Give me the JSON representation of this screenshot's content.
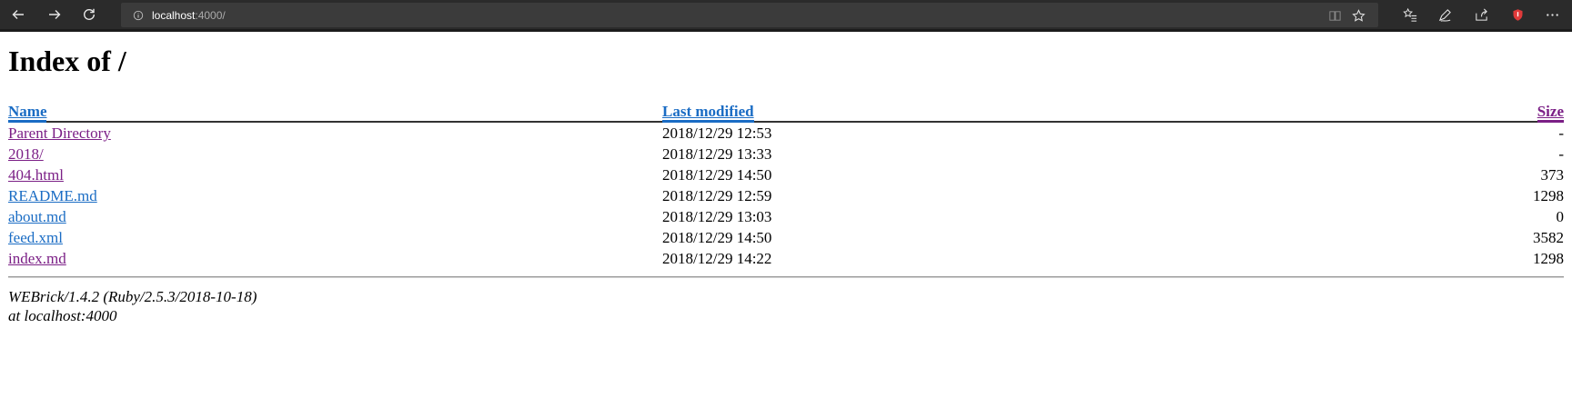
{
  "browser": {
    "url_host": "localhost",
    "url_rest": ":4000/",
    "icons": {
      "back": "arrow-left-icon",
      "forward": "arrow-right-icon",
      "refresh": "refresh-icon",
      "info": "info-icon",
      "reading_view": "reading-view-icon",
      "favorite": "star-icon",
      "favorites_list": "favorites-list-icon",
      "pen": "pen-icon",
      "share": "share-icon",
      "extension": "shield-extension-icon",
      "more": "more-icon"
    }
  },
  "page": {
    "title": "Index of /",
    "columns": {
      "name": "Name",
      "modified": "Last modified",
      "size": "Size"
    },
    "rows": [
      {
        "name": "Parent Directory",
        "modified": "2018/12/29 12:53",
        "size": "-",
        "visited": true
      },
      {
        "name": "2018/",
        "modified": "2018/12/29 13:33",
        "size": "-",
        "visited": true
      },
      {
        "name": "404.html",
        "modified": "2018/12/29 14:50",
        "size": "373",
        "visited": true
      },
      {
        "name": "README.md",
        "modified": "2018/12/29 12:59",
        "size": "1298",
        "visited": false
      },
      {
        "name": "about.md",
        "modified": "2018/12/29 13:03",
        "size": "0",
        "visited": false
      },
      {
        "name": "feed.xml",
        "modified": "2018/12/29 14:50",
        "size": "3582",
        "visited": false
      },
      {
        "name": "index.md",
        "modified": "2018/12/29 14:22",
        "size": "1298",
        "visited": true
      }
    ],
    "footer_line1": "WEBrick/1.4.2 (Ruby/2.5.3/2018-10-18)",
    "footer_line2": "at localhost:4000"
  },
  "colors": {
    "link": "#1a6cc4",
    "visited": "#7b1f86",
    "chrome_bg": "#2b2b2b",
    "extension_red": "#e03a3a"
  }
}
